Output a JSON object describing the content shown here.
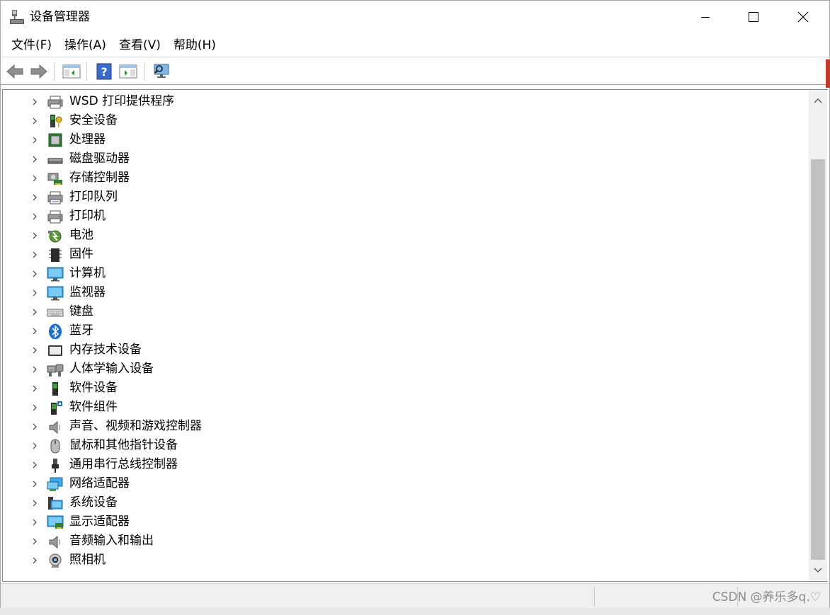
{
  "window": {
    "title": "设备管理器",
    "accent_color": "#0078d7"
  },
  "menu": {
    "items": [
      {
        "label": "文件(F)"
      },
      {
        "label": "操作(A)"
      },
      {
        "label": "查看(V)"
      },
      {
        "label": "帮助(H)"
      }
    ]
  },
  "toolbar": {
    "buttons": [
      "back-arrow-icon",
      "forward-arrow-icon",
      "show-hide-console-tree-icon",
      "help-icon",
      "properties-pane-icon",
      "scan-hardware-icon"
    ]
  },
  "tree": {
    "items": [
      {
        "label": "WSD 打印提供程序",
        "icon": "printer-icon"
      },
      {
        "label": "安全设备",
        "icon": "security-device-icon"
      },
      {
        "label": "处理器",
        "icon": "processor-icon"
      },
      {
        "label": "磁盘驱动器",
        "icon": "disk-drive-icon"
      },
      {
        "label": "存储控制器",
        "icon": "storage-controller-icon"
      },
      {
        "label": "打印队列",
        "icon": "print-queue-icon"
      },
      {
        "label": "打印机",
        "icon": "printer-icon"
      },
      {
        "label": "电池",
        "icon": "battery-icon"
      },
      {
        "label": "固件",
        "icon": "firmware-icon"
      },
      {
        "label": "计算机",
        "icon": "computer-icon"
      },
      {
        "label": "监视器",
        "icon": "monitor-icon"
      },
      {
        "label": "键盘",
        "icon": "keyboard-icon"
      },
      {
        "label": "蓝牙",
        "icon": "bluetooth-icon"
      },
      {
        "label": "内存技术设备",
        "icon": "memory-device-icon"
      },
      {
        "label": "人体学输入设备",
        "icon": "hid-icon"
      },
      {
        "label": "软件设备",
        "icon": "software-device-icon"
      },
      {
        "label": "软件组件",
        "icon": "software-component-icon"
      },
      {
        "label": "声音、视频和游戏控制器",
        "icon": "sound-icon"
      },
      {
        "label": "鼠标和其他指针设备",
        "icon": "mouse-icon"
      },
      {
        "label": "通用串行总线控制器",
        "icon": "usb-icon"
      },
      {
        "label": "网络适配器",
        "icon": "network-adapter-icon"
      },
      {
        "label": "系统设备",
        "icon": "system-device-icon"
      },
      {
        "label": "显示适配器",
        "icon": "display-adapter-icon"
      },
      {
        "label": "音频输入和输出",
        "icon": "audio-io-icon"
      },
      {
        "label": "照相机",
        "icon": "camera-icon"
      }
    ]
  },
  "status": {
    "watermark": "CSDN @养乐多q.♡"
  }
}
